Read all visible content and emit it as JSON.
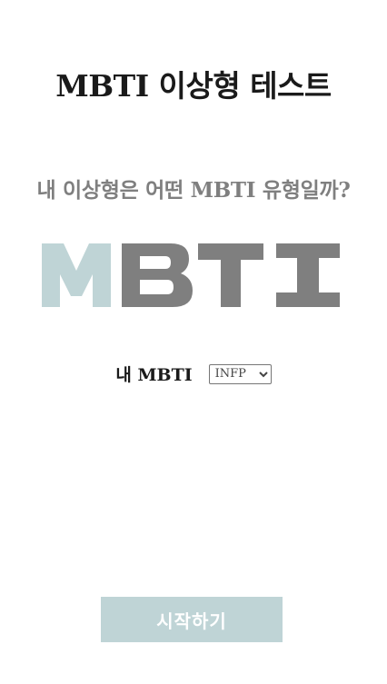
{
  "header": {
    "title": "MBTI 이상형 테스트"
  },
  "main": {
    "subtitle": "내 이상형은 어떤 MBTI 유형일까?",
    "logo_text": "MBTI",
    "logo_colors": {
      "m": "#bfd4d6",
      "rest": "#7f7f7f"
    },
    "mbti_select": {
      "label": "내 MBTI",
      "selected": "INFP"
    },
    "start_button_label": "시작하기"
  },
  "colors": {
    "title": "#1a1a1a",
    "subtitle": "#7f7f7f",
    "accent": "#bfd4d6"
  }
}
